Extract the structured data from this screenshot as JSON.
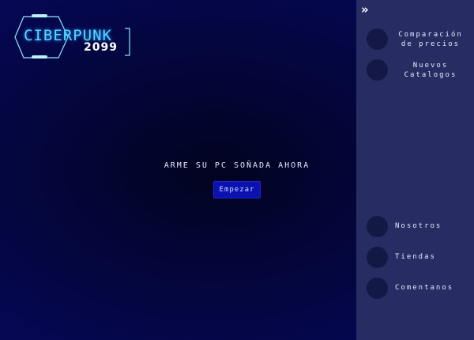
{
  "logo": {
    "main": "CIBERPUNK",
    "sub": "2099"
  },
  "hero": {
    "title": "ARME SU PC SOÑADA AHORA",
    "button": "Empezar"
  },
  "sidebar": {
    "collapse_icon": "double-chevron-right-icon",
    "items": [
      {
        "label": "Comparación de precios"
      },
      {
        "label": "Nuevos Catalogos"
      },
      {
        "label": "Nosotros"
      },
      {
        "label": "Tiendas"
      },
      {
        "label": "Comentanos"
      }
    ]
  },
  "colors": {
    "sidebar": "#272c62",
    "button": "#0b12b0",
    "accent": "#57d6ff"
  }
}
